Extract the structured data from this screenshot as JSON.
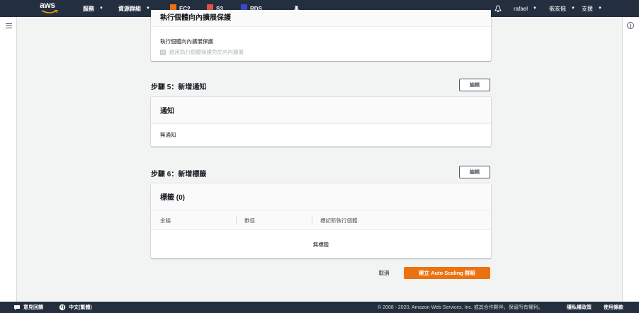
{
  "nav": {
    "logo": "aws",
    "services": "服務",
    "resource_groups": "資源群組",
    "pins": [
      {
        "label": "EC2",
        "color": "#ec7211"
      },
      {
        "label": "S3",
        "color": "#e05243"
      },
      {
        "label": "RDS",
        "color": "#3b48cc"
      }
    ],
    "user": "rafael",
    "region": "俄亥俄",
    "support": "支援"
  },
  "step4": {
    "panel_title": "執行個體向內擴展保護",
    "field_label": "執行個體向內擴展保護",
    "checkbox_label": "啟用執行個體保護免於向內擴展"
  },
  "step5": {
    "title": "步驟 5：新增通知",
    "edit_label": "編輯",
    "panel_title": "通知",
    "empty_text": "無通知"
  },
  "step6": {
    "title": "步驟 6：新增標籤",
    "edit_label": "編輯",
    "panel_title": "標籤 (0)",
    "columns": [
      "金鑰",
      "數值",
      "標記新執行個體"
    ],
    "empty_text": "無標籤"
  },
  "actions": {
    "cancel": "取消",
    "create": "建立 Auto Scaling 群組"
  },
  "footer": {
    "feedback": "意見回饋",
    "language": "中文(繁體)",
    "copyright": "© 2008 - 2020, Amazon Web Services, Inc. 或其合作夥伴。保留所有權利。",
    "privacy": "隱私權政策",
    "terms": "使用條款"
  },
  "colors": {
    "nav_bg": "#232f3e",
    "primary": "#ec7211"
  }
}
